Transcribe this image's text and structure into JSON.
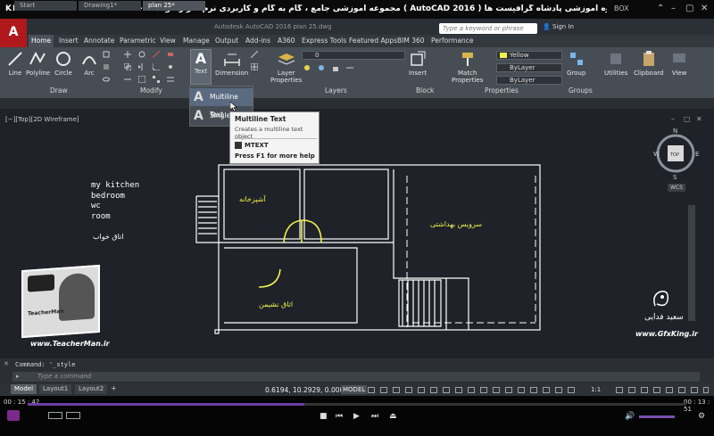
{
  "player": {
    "logo": "KMPLAYER",
    "title": "مجموعه آموزشی جامع ، گام به گام و کاربردی نرم افزار اتوکد ۲۰۱۶ ( AutoCAD 2016 ) مدرس : سعید فدایی (تیچرمن) گروه آموزشی پادشاه گرافیست ها",
    "box_label": "BOX",
    "time_current": "00 : 15 : 42",
    "time_total": "00 : 13 : 51",
    "progress": 0.42
  },
  "acad": {
    "logo": "A",
    "doc_title": "Autodesk AutoCAD 2016    plan 25.dwg",
    "search_placeholder": "Type a keyword or phrase",
    "signin": "Sign In"
  },
  "ribbon_tabs": [
    "Home",
    "Insert",
    "Annotate",
    "Parametric",
    "View",
    "Manage",
    "Output",
    "Add-ins",
    "A360",
    "Express Tools",
    "Featured Apps",
    "BIM 360",
    "Performance"
  ],
  "ribbon": {
    "draw": {
      "line": "Line",
      "polyline": "Polyline",
      "circle": "Circle",
      "arc": "Arc",
      "label": "Draw"
    },
    "modify": {
      "label": "Modify"
    },
    "annotation": {
      "text": "Text",
      "dimension": "Dimension"
    },
    "layers": {
      "properties": "Layer\nProperties",
      "label": "Layers",
      "current": "0"
    },
    "block": {
      "insert": "Insert",
      "label": "Block"
    },
    "properties": {
      "match": "Match\nProperties",
      "color": "Yellow",
      "linetype": "ByLayer",
      "lineweight": "ByLayer",
      "label": "Properties"
    },
    "groups": {
      "group": "Group",
      "label": "Groups"
    },
    "utilities": "Utilities",
    "clipboard": "Clipboard",
    "view": "View"
  },
  "file_tabs": [
    "Start",
    "Drawing1*",
    "plan 25*"
  ],
  "text_dropdown": {
    "items": [
      "Multiline Text",
      "Single Line"
    ]
  },
  "tooltip": {
    "title": "Multiline Text",
    "desc": "Creates a multiline text object",
    "cmd": "MTEXT",
    "help": "Press F1 for more help"
  },
  "viewport": {
    "label": "[−][Top][2D Wireframe]",
    "compass": {
      "n": "N",
      "s": "S",
      "e": "E",
      "w": "W",
      "top": "TOP"
    },
    "wcs": "WCS"
  },
  "drawing_notes": [
    "my kitchen",
    "bedroom",
    "wc",
    "room"
  ],
  "drawing_note_fa": "اتاق خواب",
  "room_labels": {
    "kitchen": "آشپزخانه",
    "bath": "سرویس بهداشتی",
    "living": "اتاق نشیمن"
  },
  "watermarks": {
    "teacher": "www.TeacherMan.ir",
    "gfx": "www.GfxKing.ir",
    "gfx_name": "سعید فدایی",
    "badge": "TeacherMan"
  },
  "command": {
    "history": "Command: '_style",
    "placeholder": "Type a command"
  },
  "layout_tabs": [
    "Model",
    "Layout1",
    "Layout2"
  ],
  "status": {
    "coords": "0.6194, 10.2929, 0.0000",
    "model": "MODEL",
    "scale": "1:1"
  },
  "colors": {
    "ribbon": "#474d55",
    "canvas": "#1f2228",
    "drawing_lines": "#ffffff",
    "door_arcs": "#f2f24a"
  }
}
